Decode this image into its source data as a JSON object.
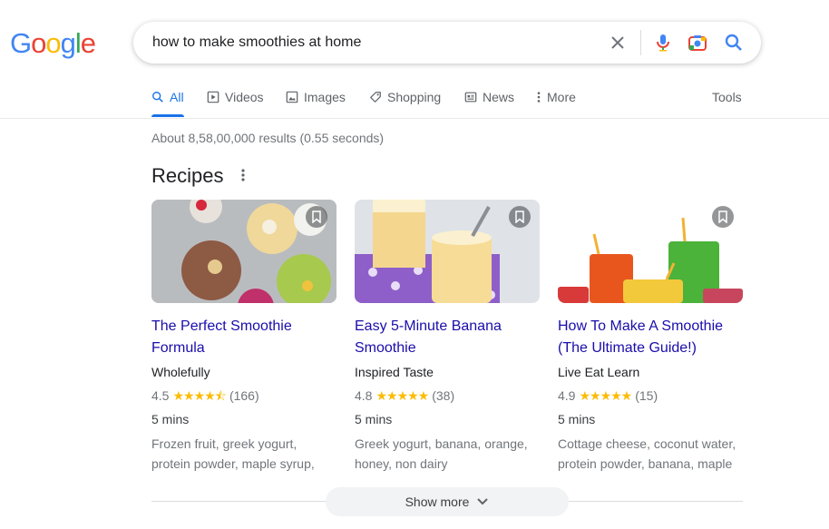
{
  "logo": {
    "letters": [
      "G",
      "o",
      "o",
      "g",
      "l",
      "e"
    ],
    "colors": [
      "#4285f4",
      "#ea4335",
      "#fbbc05",
      "#4285f4",
      "#34a853",
      "#ea4335"
    ]
  },
  "search": {
    "query": "how to make smoothies at home"
  },
  "tabs": [
    {
      "label": "All",
      "icon": "search-icon"
    },
    {
      "label": "Videos",
      "icon": "video-icon"
    },
    {
      "label": "Images",
      "icon": "image-icon"
    },
    {
      "label": "Shopping",
      "icon": "tag-icon"
    },
    {
      "label": "News",
      "icon": "news-icon"
    },
    {
      "label": "More",
      "icon": "more-vert-icon"
    }
  ],
  "tools_label": "Tools",
  "stats": "About 8,58,00,000 results (0.55 seconds)",
  "section_title": "Recipes",
  "recipes": [
    {
      "title_line1": "The Perfect Smoothie",
      "title_line2": "Formula",
      "source": "Wholefully",
      "rating": "4.5",
      "stars": "★★★★⯪",
      "reviews": "(166)",
      "time": "5 mins",
      "ingredients_line1": "Frozen fruit, greek yogurt,",
      "ingredients_line2": "protein powder, maple syrup,"
    },
    {
      "title_line1": "Easy 5-Minute Banana",
      "title_line2": "Smoothie",
      "source": "Inspired Taste",
      "rating": "4.8",
      "stars": "★★★★★",
      "reviews": "(38)",
      "time": "5 mins",
      "ingredients_line1": "Greek yogurt, banana, orange,",
      "ingredients_line2": "honey, non dairy"
    },
    {
      "title_line1": "How To Make A Smoothie",
      "title_line2": "(The Ultimate Guide!)",
      "source": "Live Eat Learn",
      "rating": "4.9",
      "stars": "★★★★★",
      "reviews": "(15)",
      "time": "5 mins",
      "ingredients_line1": "Cottage cheese, coconut water,",
      "ingredients_line2": "protein powder, banana, maple"
    }
  ],
  "show_more": "Show more"
}
